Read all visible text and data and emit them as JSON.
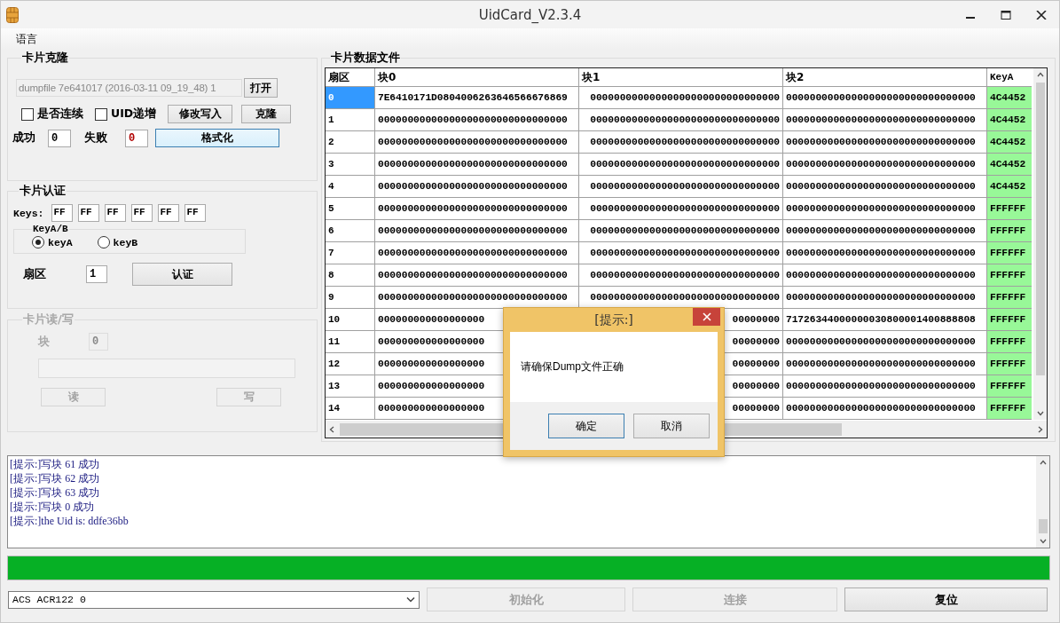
{
  "window": {
    "title": "UidCard_V2.3.4"
  },
  "menu": [
    "语言"
  ],
  "clone": {
    "title": "卡片克隆",
    "file_value": "dumpfile 7e641017 (2016-03-11 09_19_48) 1",
    "open_button": "打开",
    "checkboxes": [
      {
        "label": "是否连续",
        "checked": false
      },
      {
        "label": "UID递增",
        "checked": false
      }
    ],
    "buttons": [
      "修改写入",
      "克隆"
    ],
    "success_label": "成功",
    "success_value": "0",
    "fail_label": "失败",
    "fail_value": "0",
    "format_button": "格式化"
  },
  "auth": {
    "title": "卡片认证",
    "keys_label": "Keys:",
    "keys": [
      "FF",
      "FF",
      "FF",
      "FF",
      "FF",
      "FF"
    ],
    "key_group_title": "KeyA/B",
    "radios": [
      {
        "label": "keyA",
        "selected": true
      },
      {
        "label": "keyB",
        "selected": false
      }
    ],
    "sector_label": "扇区",
    "sector_value": "1",
    "auth_button": "认证"
  },
  "readwrite": {
    "title": "卡片读/写",
    "disabled": true,
    "block_label": "块",
    "block_value": "0",
    "read_button": "读",
    "write_button": "写"
  },
  "table": {
    "title": "卡片数据文件",
    "columns": [
      "扇区",
      "块0",
      "块1",
      "块2",
      "KeyA"
    ],
    "rows": [
      {
        "selected": true,
        "cells": [
          "0",
          "7E6410171D0804006263646566676869",
          "00000000000000000000000000000000",
          "00000000000000000000000000000000",
          "4C4452"
        ]
      },
      {
        "selected": false,
        "cells": [
          "1",
          "00000000000000000000000000000000",
          "00000000000000000000000000000000",
          "00000000000000000000000000000000",
          "4C4452"
        ]
      },
      {
        "selected": false,
        "cells": [
          "2",
          "00000000000000000000000000000000",
          "00000000000000000000000000000000",
          "00000000000000000000000000000000",
          "4C4452"
        ]
      },
      {
        "selected": false,
        "cells": [
          "3",
          "00000000000000000000000000000000",
          "00000000000000000000000000000000",
          "00000000000000000000000000000000",
          "4C4452"
        ]
      },
      {
        "selected": false,
        "cells": [
          "4",
          "00000000000000000000000000000000",
          "00000000000000000000000000000000",
          "00000000000000000000000000000000",
          "4C4452"
        ]
      },
      {
        "selected": false,
        "cells": [
          "5",
          "00000000000000000000000000000000",
          "00000000000000000000000000000000",
          "00000000000000000000000000000000",
          "FFFFFF"
        ]
      },
      {
        "selected": false,
        "cells": [
          "6",
          "00000000000000000000000000000000",
          "00000000000000000000000000000000",
          "00000000000000000000000000000000",
          "FFFFFF"
        ]
      },
      {
        "selected": false,
        "cells": [
          "7",
          "00000000000000000000000000000000",
          "00000000000000000000000000000000",
          "00000000000000000000000000000000",
          "FFFFFF"
        ]
      },
      {
        "selected": false,
        "cells": [
          "8",
          "00000000000000000000000000000000",
          "00000000000000000000000000000000",
          "00000000000000000000000000000000",
          "FFFFFF"
        ]
      },
      {
        "selected": false,
        "cells": [
          "9",
          "00000000000000000000000000000000",
          "00000000000000000000000000000000",
          "00000000000000000000000000000000",
          "FFFFFF"
        ]
      },
      {
        "selected": false,
        "cells": [
          "10",
          "000000000000000000",
          "00000000",
          "71726344000000030800001400888808",
          "FFFFFF"
        ]
      },
      {
        "selected": false,
        "cells": [
          "11",
          "000000000000000000",
          "00000000",
          "00000000000000000000000000000000",
          "FFFFFF"
        ]
      },
      {
        "selected": false,
        "cells": [
          "12",
          "000000000000000000",
          "00000000",
          "00000000000000000000000000000000",
          "FFFFFF"
        ]
      },
      {
        "selected": false,
        "cells": [
          "13",
          "000000000000000000",
          "00000000",
          "00000000000000000000000000000000",
          "FFFFFF"
        ]
      },
      {
        "selected": false,
        "cells": [
          "14",
          "000000000000000000",
          "00000000",
          "00000000000000000000000000000000",
          "FFFFFF"
        ]
      }
    ]
  },
  "log": [
    "[提示:]写块 61 成功",
    "[提示:]写块 62 成功",
    "[提示:]写块 63 成功",
    "[提示:]写块 0 成功",
    "[提示:]the Uid is: ddfe36bb"
  ],
  "progress": {
    "level": 1
  },
  "reader": {
    "value": "ACS ACR122 0"
  },
  "bottom_buttons": [
    {
      "label": "初始化",
      "disabled": true
    },
    {
      "label": "连接",
      "disabled": true
    },
    {
      "label": "复位",
      "disabled": false
    }
  ],
  "dialog": {
    "title": "[提示:]",
    "message": "请确保Dump文件正确",
    "buttons": [
      "确定",
      "取消"
    ]
  }
}
